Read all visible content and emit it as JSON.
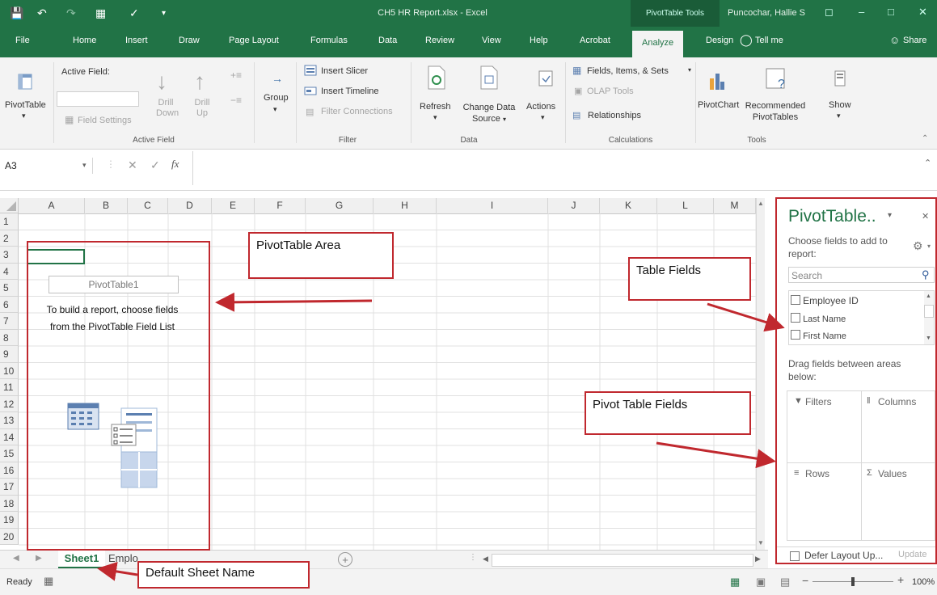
{
  "titlebar": {
    "title": "CH5 HR Report.xlsx  -  Excel",
    "tools_label": "PivotTable Tools",
    "user": "Puncochar, Hallie S"
  },
  "tabs": [
    "File",
    "Home",
    "Insert",
    "Draw",
    "Page Layout",
    "Formulas",
    "Data",
    "Review",
    "View",
    "Help",
    "Acrobat",
    "Analyze",
    "Design",
    "Tell me",
    "Share"
  ],
  "ribbon": {
    "pivottable": "PivotTable",
    "active_field_label": "Active Field:",
    "field_settings": "Field Settings",
    "drill_down": [
      "Drill",
      "Down"
    ],
    "drill_up": [
      "Drill",
      "Up"
    ],
    "active_field_group": "Active Field",
    "group": "Group",
    "insert_slicer": "Insert Slicer",
    "insert_timeline": "Insert Timeline",
    "filter_connections": "Filter Connections",
    "filter_group": "Filter",
    "refresh": "Refresh",
    "change_data_source": [
      "Change Data",
      "Source"
    ],
    "data_group": "Data",
    "actions": "Actions",
    "fields_items_sets": "Fields, Items, & Sets",
    "olap_tools": "OLAP Tools",
    "relationships": "Relationships",
    "calculations_group": "Calculations",
    "pivotchart": "PivotChart",
    "recommended_pivottables": [
      "Recommended",
      "PivotTables"
    ],
    "show": "Show",
    "tools_group": "Tools"
  },
  "formula_bar": {
    "name_box": "A3",
    "fx": "fx"
  },
  "grid": {
    "columns": [
      "A",
      "B",
      "C",
      "D",
      "E",
      "F",
      "G",
      "H",
      "I",
      "J",
      "K",
      "L",
      "M"
    ],
    "rows": [
      "1",
      "2",
      "3",
      "4",
      "5",
      "6",
      "7",
      "8",
      "9",
      "10",
      "11",
      "12",
      "13",
      "14",
      "15",
      "16",
      "17",
      "18",
      "19",
      "20"
    ],
    "pivot_name": "PivotTable1",
    "pivot_instructions": [
      "To build a report, choose fields",
      "from the PivotTable Field List"
    ]
  },
  "pane": {
    "title": "PivotTable..",
    "choose_fields": [
      "Choose fields to add to",
      "report:"
    ],
    "search_placeholder": "Search",
    "fields": [
      "Employee ID",
      "Last Name",
      "First Name"
    ],
    "drag_label": [
      "Drag fields between areas",
      "below:"
    ],
    "areas": [
      "Filters",
      "Columns",
      "Rows",
      "Values"
    ],
    "defer": "Defer Layout Up...",
    "update": "Update"
  },
  "sheets": {
    "active": "Sheet1",
    "next": "Emplo"
  },
  "status": {
    "ready": "Ready",
    "zoom": "100%"
  },
  "annotations": {
    "pivot_area": "PivotTable Area",
    "table_fields": "Table Fields",
    "pivot_table_fields": "Pivot Table Fields",
    "default_sheet_name": "Default Sheet Name"
  },
  "colors": {
    "excel_green": "#217346",
    "annotation_red": "#c0282e"
  }
}
